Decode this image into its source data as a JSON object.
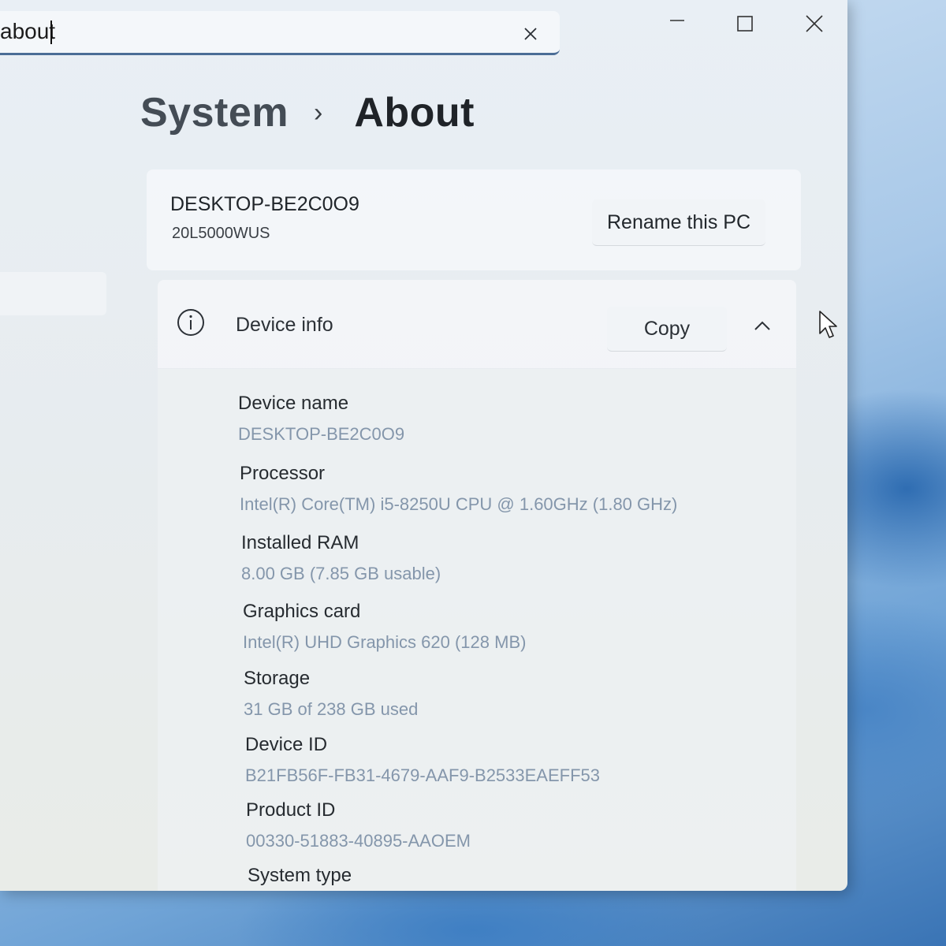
{
  "search": {
    "query": "about",
    "clear_icon": "close-icon"
  },
  "window_controls": {
    "minimize_icon": "minimize-icon",
    "maximize_icon": "maximize-icon",
    "close_icon": "close-icon"
  },
  "breadcrumb": {
    "parent": "System",
    "separator": "›",
    "current": "About"
  },
  "pc_card": {
    "device_name": "DESKTOP-BE2C0O9",
    "model": "20L5000WUS",
    "rename_label": "Rename this PC"
  },
  "device_info": {
    "icon": "info-icon",
    "title": "Device info",
    "copy_label": "Copy",
    "expanded": true,
    "properties": [
      {
        "label": "Device name",
        "value": "DESKTOP-BE2C0O9"
      },
      {
        "label": "Processor",
        "value": "Intel(R) Core(TM) i5-8250U CPU @ 1.60GHz (1.80 GHz)"
      },
      {
        "label": "Installed RAM",
        "value": "8.00 GB (7.85 GB usable)"
      },
      {
        "label": "Graphics card",
        "value": "Intel(R) UHD Graphics 620 (128 MB)"
      },
      {
        "label": "Storage",
        "value": "31 GB of 238 GB used"
      },
      {
        "label": "Device ID",
        "value": "B21FB56F-FB31-4679-AAF9-B2533EAEFF53"
      },
      {
        "label": "Product ID",
        "value": "00330-51883-40895-AAOEM"
      },
      {
        "label": "System type",
        "value": ""
      }
    ]
  },
  "colors": {
    "accent": "#4b6d96",
    "value_text": "#8496ab"
  }
}
